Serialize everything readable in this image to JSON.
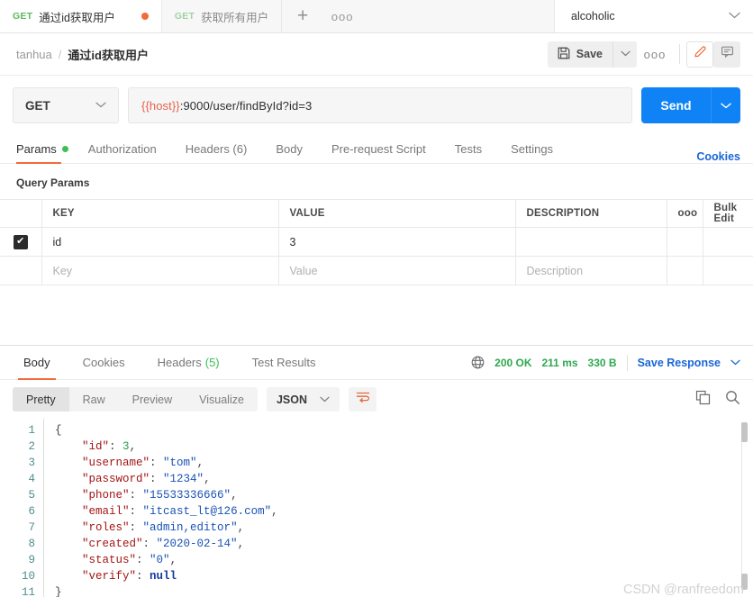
{
  "tabbar": {
    "tabs": [
      {
        "method": "GET",
        "name": "通过id获取用户",
        "unsaved_dot": true
      },
      {
        "method": "GET",
        "name": "获取所有用户",
        "unsaved_dot": false
      }
    ],
    "new_tab_label": "+",
    "more_label": "ooo",
    "environment": "alcoholic"
  },
  "breadcrumb": {
    "root": "tanhua",
    "separator": "/",
    "current": "通过id获取用户"
  },
  "actions": {
    "save_label": "Save",
    "more_label": "ooo"
  },
  "request": {
    "method": "GET",
    "url_variable": "{{host}}",
    "url_rest": ":9000/user/findById?id=3",
    "send_label": "Send"
  },
  "request_tabs": [
    {
      "label": "Params",
      "active": true,
      "dot": true
    },
    {
      "label": "Authorization",
      "active": false
    },
    {
      "label": "Headers (6)",
      "active": false
    },
    {
      "label": "Body",
      "active": false
    },
    {
      "label": "Pre-request Script",
      "active": false
    },
    {
      "label": "Tests",
      "active": false
    },
    {
      "label": "Settings",
      "active": false
    }
  ],
  "cookies_link": "Cookies",
  "query_params": {
    "title": "Query Params",
    "columns": [
      "KEY",
      "VALUE",
      "DESCRIPTION"
    ],
    "more_label": "ooo",
    "bulk_edit_label": "Bulk Edit",
    "rows": [
      {
        "checked": true,
        "key": "id",
        "value": "3",
        "description": ""
      }
    ],
    "placeholders": {
      "key": "Key",
      "value": "Value",
      "description": "Description"
    }
  },
  "response": {
    "tabs": [
      {
        "label": "Body",
        "active": true
      },
      {
        "label": "Cookies",
        "active": false
      },
      {
        "label": "Headers",
        "count": "(5)",
        "active": false
      },
      {
        "label": "Test Results",
        "active": false
      }
    ],
    "status": "200 OK",
    "time": "211 ms",
    "size": "330 B",
    "save_response_label": "Save Response",
    "view_modes": [
      "Pretty",
      "Raw",
      "Preview",
      "Visualize"
    ],
    "active_view_mode": "Pretty",
    "format": "JSON",
    "line_numbers": [
      "1",
      "2",
      "3",
      "4",
      "5",
      "6",
      "7",
      "8",
      "9",
      "10",
      "11"
    ],
    "body_lines": [
      {
        "indent": 0,
        "tokens": [
          {
            "t": "{",
            "c": "br"
          }
        ]
      },
      {
        "indent": 1,
        "tokens": [
          {
            "t": "\"id\"",
            "c": "k"
          },
          {
            "t": ": ",
            "c": "br"
          },
          {
            "t": "3",
            "c": "n"
          },
          {
            "t": ",",
            "c": "br"
          }
        ]
      },
      {
        "indent": 1,
        "tokens": [
          {
            "t": "\"username\"",
            "c": "k"
          },
          {
            "t": ": ",
            "c": "br"
          },
          {
            "t": "\"tom\"",
            "c": "s"
          },
          {
            "t": ",",
            "c": "br"
          }
        ]
      },
      {
        "indent": 1,
        "tokens": [
          {
            "t": "\"password\"",
            "c": "k"
          },
          {
            "t": ": ",
            "c": "br"
          },
          {
            "t": "\"1234\"",
            "c": "s"
          },
          {
            "t": ",",
            "c": "br"
          }
        ]
      },
      {
        "indent": 1,
        "tokens": [
          {
            "t": "\"phone\"",
            "c": "k"
          },
          {
            "t": ": ",
            "c": "br"
          },
          {
            "t": "\"15533336666\"",
            "c": "s"
          },
          {
            "t": ",",
            "c": "br"
          }
        ]
      },
      {
        "indent": 1,
        "tokens": [
          {
            "t": "\"email\"",
            "c": "k"
          },
          {
            "t": ": ",
            "c": "br"
          },
          {
            "t": "\"itcast_lt@126.com\"",
            "c": "s"
          },
          {
            "t": ",",
            "c": "br"
          }
        ]
      },
      {
        "indent": 1,
        "tokens": [
          {
            "t": "\"roles\"",
            "c": "k"
          },
          {
            "t": ": ",
            "c": "br"
          },
          {
            "t": "\"admin,editor\"",
            "c": "s"
          },
          {
            "t": ",",
            "c": "br"
          }
        ]
      },
      {
        "indent": 1,
        "tokens": [
          {
            "t": "\"created\"",
            "c": "k"
          },
          {
            "t": ": ",
            "c": "br"
          },
          {
            "t": "\"2020-02-14\"",
            "c": "s"
          },
          {
            "t": ",",
            "c": "br"
          }
        ]
      },
      {
        "indent": 1,
        "tokens": [
          {
            "t": "\"status\"",
            "c": "k"
          },
          {
            "t": ": ",
            "c": "br"
          },
          {
            "t": "\"0\"",
            "c": "s"
          },
          {
            "t": ",",
            "c": "br"
          }
        ]
      },
      {
        "indent": 1,
        "tokens": [
          {
            "t": "\"verify\"",
            "c": "k"
          },
          {
            "t": ": ",
            "c": "br"
          },
          {
            "t": "null",
            "c": "nul"
          }
        ]
      },
      {
        "indent": 0,
        "tokens": [
          {
            "t": "}",
            "c": "br"
          }
        ]
      }
    ]
  },
  "watermark": "CSDN @ranfreedom",
  "colors": {
    "accent_orange": "#f26b3a",
    "send_blue": "#0f83f5",
    "link_blue": "#1a66d8",
    "status_green": "#2fa84f",
    "method_green": "#5cb85c",
    "var_red": "#e8604c"
  }
}
